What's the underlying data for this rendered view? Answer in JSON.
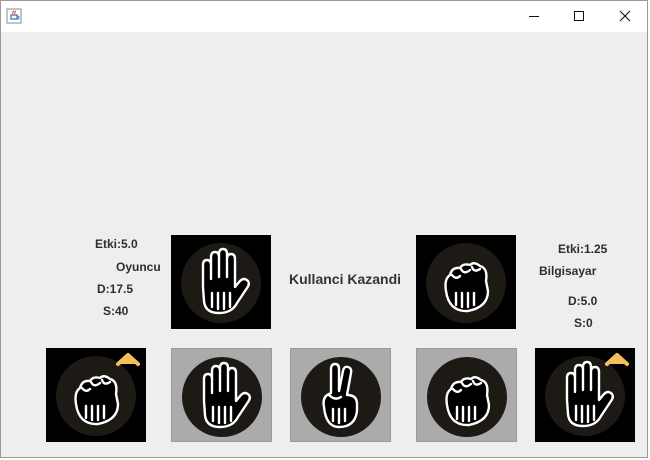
{
  "window": {
    "title": ""
  },
  "player": {
    "etki": "Etki:5.0",
    "name": "Oyuncu",
    "d": "D:17.5",
    "s": "S:40",
    "chosen_card": "paper"
  },
  "computer": {
    "etki": "Etki:1.25",
    "name": "Bilgisayar",
    "d": "D:5.0",
    "s": "S:0",
    "chosen_card": "rock"
  },
  "result": "Kullanci Kazandi",
  "cards": [
    {
      "type": "rock",
      "enabled": true,
      "selected_marker": true
    },
    {
      "type": "paper",
      "enabled": false,
      "selected_marker": false
    },
    {
      "type": "scissors",
      "enabled": false,
      "selected_marker": false
    },
    {
      "type": "rock",
      "enabled": false,
      "selected_marker": false
    },
    {
      "type": "paper",
      "enabled": true,
      "selected_marker": true
    }
  ],
  "colors": {
    "window_bg": "#eeeeee",
    "card_bg": "#000000",
    "card_disabled_bg": "#ababab",
    "marker": "#f2c05a"
  },
  "icons": {
    "app": "java-cup-icon",
    "minimize": "minimize-icon",
    "maximize": "maximize-icon",
    "close": "close-icon"
  }
}
